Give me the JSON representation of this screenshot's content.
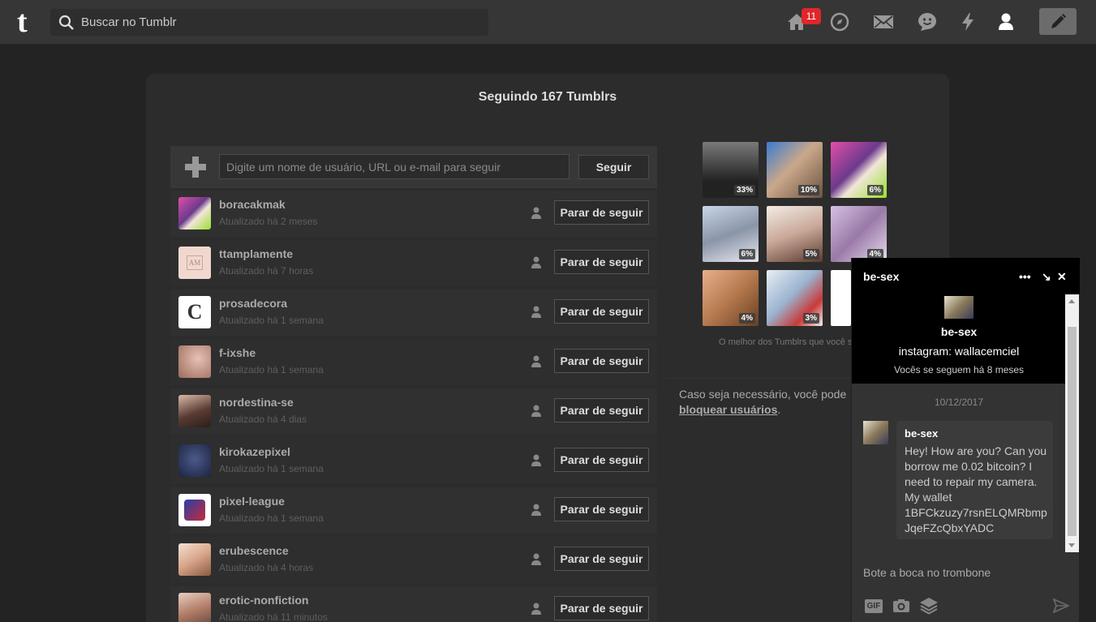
{
  "header": {
    "logo": "t",
    "search_placeholder": "Buscar no Tumblr",
    "notification_count": "11",
    "icons": [
      "home-icon",
      "explore-icon",
      "inbox-icon",
      "messaging-icon",
      "activity-icon",
      "account-icon",
      "compose-icon"
    ]
  },
  "page": {
    "title": "Seguindo 167 Tumblrs",
    "follow_placeholder": "Digite um nome de usuário, URL ou e-mail para seguir",
    "follow_button": "Seguir",
    "unfollow_label": "Parar de seguir",
    "following": [
      {
        "name": "boracakmak",
        "updated": "Atualizado há 2 meses"
      },
      {
        "name": "ttamplamente",
        "updated": "Atualizado há 7 horas"
      },
      {
        "name": "prosadecora",
        "updated": "Atualizado há 1 semana"
      },
      {
        "name": "f-ixshe",
        "updated": "Atualizado há 1 semana"
      },
      {
        "name": "nordestina-se",
        "updated": "Atualizado há 4 dias"
      },
      {
        "name": "kirokazepixel",
        "updated": "Atualizado há 1 semana"
      },
      {
        "name": "pixel-league",
        "updated": "Atualizado há 1 semana"
      },
      {
        "name": "erubescence",
        "updated": "Atualizado há 4 horas"
      },
      {
        "name": "erotic-nonfiction",
        "updated": "Atualizado há 11 minutos"
      }
    ],
    "best_of": {
      "percents": [
        "33%",
        "10%",
        "6%",
        "6%",
        "5%",
        "4%",
        "4%",
        "3%",
        ""
      ],
      "caption": "O melhor dos Tumblrs que você s"
    },
    "block_text": "Caso seja necessário, você pode",
    "block_link": "bloquear usuários",
    "block_end": "."
  },
  "chat": {
    "name": "be-sex",
    "controls": {
      "more": "•••",
      "minimize": "↘",
      "close": "✕"
    },
    "profile_name": "be-sex",
    "profile_bio": "instagram: wallacemciel",
    "profile_follow": "Vocês se seguem há 8 meses",
    "date": "10/12/2017",
    "message_author": "be-sex",
    "message_text": "Hey! How are you? Can you borrow me 0.02 bitcoin? I need to repair my camera. My wallet 1BFCkzuzy7rsnELQMRbmpJqeFZcQbxYADC",
    "input_placeholder": "Bote a boca no trombone",
    "gif_label": "GIF"
  }
}
